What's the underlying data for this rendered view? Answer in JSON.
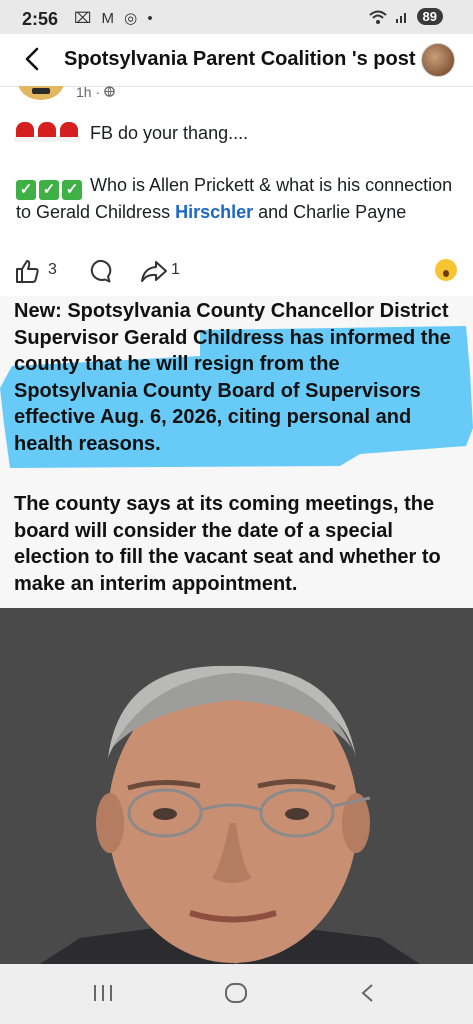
{
  "status_bar": {
    "time": "2:56",
    "notification_icons": "⌧ M ◎ •",
    "battery": "89"
  },
  "header": {
    "title": "Spotsylvania Parent Coalition 's post"
  },
  "post": {
    "time": "1h ·",
    "line1_text": "FB do your thang....",
    "para2_before": "Who is Allen Prickett & what is his connection to Gerald Childress ",
    "para2_link": "Hirschler",
    "para2_after": " and Charlie Payne",
    "like_count": "3",
    "share_count": "1"
  },
  "article_image": {
    "headline": "New: Spotsylvania County Chancellor District Supervisor Gerald Childress has informed the county that he will resign from the Spotsylvania County Board of Supervisors effective Aug. 6, 2026, citing personal and health reasons.",
    "body": "The county says at its coming meetings, the board will consider the date of a special election to fill the vacant seat and whether to make an interim appointment.",
    "highlight_color": "#4fc3f7"
  },
  "icons": [
    "back-arrow-icon",
    "like-icon",
    "comment-icon",
    "share-icon",
    "wow-reaction-icon",
    "recent-apps-icon",
    "home-icon",
    "nav-back-icon"
  ]
}
